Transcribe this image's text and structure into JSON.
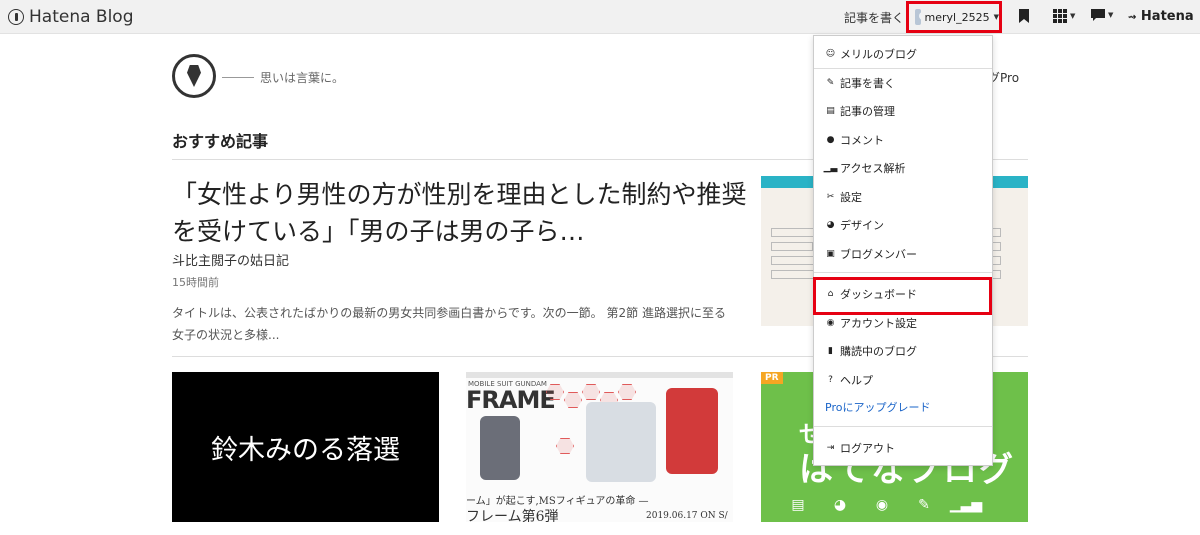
{
  "topbar": {
    "brand": "Hatena Blog",
    "write_link": "記事を書く",
    "username": "meryl_2525",
    "hatena_logo": "Hatena"
  },
  "site": {
    "tagline": "思いは言葉に。",
    "pro_fragment": "グPro"
  },
  "section": {
    "title": "おすすめ記事"
  },
  "article": {
    "title": "「女性より男性の方が性別を理由とした制約や推奨を受けている」「男の子は男の子ら…",
    "blog_name": "斗比主閲子の姑日記",
    "time": "15時間前",
    "excerpt": "タイトルは、公表されたばかりの最新の男女共同参画白書からです。次の一節。 第2節 進路選択に至る女子の状況と多様..."
  },
  "cards": [
    {
      "text": "鈴木みのる落選"
    },
    {
      "sub": "MOBILE SUIT GUNDAM",
      "title": "FRAME",
      "caption": "ーム」が起こす,MSフィギュアの革命 —",
      "title2": "フレーム第6弾",
      "date": "2019.06.17 ON S/"
    },
    {
      "badge": "PR",
      "text_top": "せ",
      "text": "はてなブログ"
    }
  ],
  "dropdown": {
    "items": [
      {
        "icon": "user-circle-icon",
        "label": "メリルのブログ"
      },
      {
        "icon": "edit-icon",
        "label": "記事を書く"
      },
      {
        "icon": "document-icon",
        "label": "記事の管理"
      },
      {
        "icon": "comment-icon",
        "label": "コメント"
      },
      {
        "icon": "analytics-icon",
        "label": "アクセス解析"
      },
      {
        "icon": "wrench-icon",
        "label": "設定"
      },
      {
        "icon": "palette-icon",
        "label": "デザイン"
      },
      {
        "icon": "members-icon",
        "label": "ブログメンバー"
      },
      {
        "icon": "home-icon",
        "label": "ダッシュボード"
      },
      {
        "icon": "account-icon",
        "label": "アカウント設定"
      },
      {
        "icon": "bookmark-icon",
        "label": "購読中のブログ"
      },
      {
        "icon": "help-icon",
        "label": "ヘルプ"
      },
      {
        "icon": "",
        "label": "Proにアップグレード"
      },
      {
        "icon": "logout-icon",
        "label": "ログアウト"
      }
    ]
  },
  "colors": {
    "highlight": "#e60012",
    "link": "#1a64c8",
    "pr_green": "#6ec04a"
  }
}
